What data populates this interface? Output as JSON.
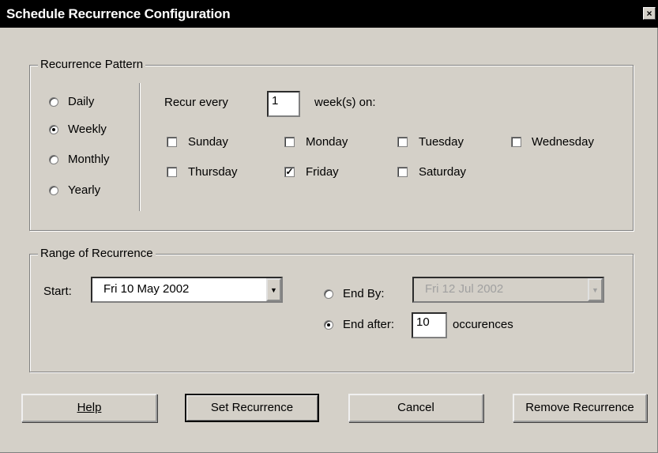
{
  "window": {
    "title": "Schedule Recurrence Configuration",
    "close_glyph": "×"
  },
  "pattern": {
    "legend": "Recurrence Pattern",
    "options": [
      {
        "label": "Daily",
        "selected": false
      },
      {
        "label": "Weekly",
        "selected": true
      },
      {
        "label": "Monthly",
        "selected": false
      },
      {
        "label": "Yearly",
        "selected": false
      }
    ],
    "recur_every_label": "Recur every",
    "recur_every_value": "1",
    "weeks_on_label": "week(s) on:",
    "days": [
      {
        "label": "Sunday",
        "checked": false
      },
      {
        "label": "Monday",
        "checked": false
      },
      {
        "label": "Tuesday",
        "checked": false
      },
      {
        "label": "Wednesday",
        "checked": false
      },
      {
        "label": "Thursday",
        "checked": false
      },
      {
        "label": "Friday",
        "checked": true
      },
      {
        "label": "Saturday",
        "checked": false
      }
    ]
  },
  "range": {
    "legend": "Range of Recurrence",
    "start_label": "Start:",
    "start_value": "Fri  10 May 2002",
    "end_by_label": "End By:",
    "end_by_value": "Fri  12 Jul  2002",
    "end_by_selected": false,
    "end_after_label": "End after:",
    "end_after_value": "10",
    "end_after_selected": true,
    "occurrences_label": "occurences"
  },
  "buttons": {
    "help_label": "Help",
    "set_label": "Set Recurrence",
    "cancel_label": "Cancel",
    "remove_label": "Remove Recurrence"
  }
}
